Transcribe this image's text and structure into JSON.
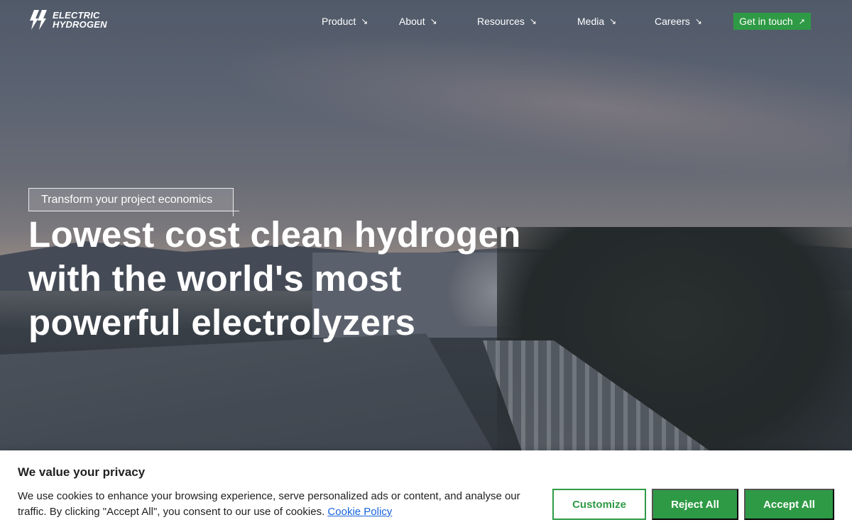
{
  "brand": {
    "logo_line1": "ELECTRIC",
    "logo_line2": "HYDROGEN",
    "icon": "lightning-bolt-logo-icon"
  },
  "nav": {
    "items": [
      {
        "label": "Product",
        "icon": "arrow-down-right-icon"
      },
      {
        "label": "About",
        "icon": "arrow-down-right-icon"
      },
      {
        "label": "Resources",
        "icon": "arrow-down-right-icon"
      },
      {
        "label": "Media",
        "icon": "arrow-down-right-icon"
      },
      {
        "label": "Careers",
        "icon": "arrow-down-right-icon"
      }
    ],
    "cta_label": "Get in touch",
    "cta_icon": "arrow-up-right-icon",
    "arrow_down_glyph": "↘",
    "arrow_up_glyph": "↗"
  },
  "hero": {
    "tagline": "Transform your project economics",
    "headline_lines": [
      "Lowest cost clean hydrogen",
      "with the world's most",
      "powerful electrolyzers"
    ]
  },
  "cookie": {
    "title": "We value your privacy",
    "text_line1": "We use cookies to enhance your browsing experience, serve personalized ads or content, and analyse our",
    "text_line2": "traffic. By clicking \"Accept All\", you consent to our use of cookies.",
    "link_label": "Cookie Policy",
    "customize_label": "Customize",
    "reject_label": "Reject All",
    "accept_label": "Accept All"
  },
  "colors": {
    "accent_green": "#2f9a45",
    "link_blue": "#1863dc",
    "text_dark": "#212121"
  }
}
